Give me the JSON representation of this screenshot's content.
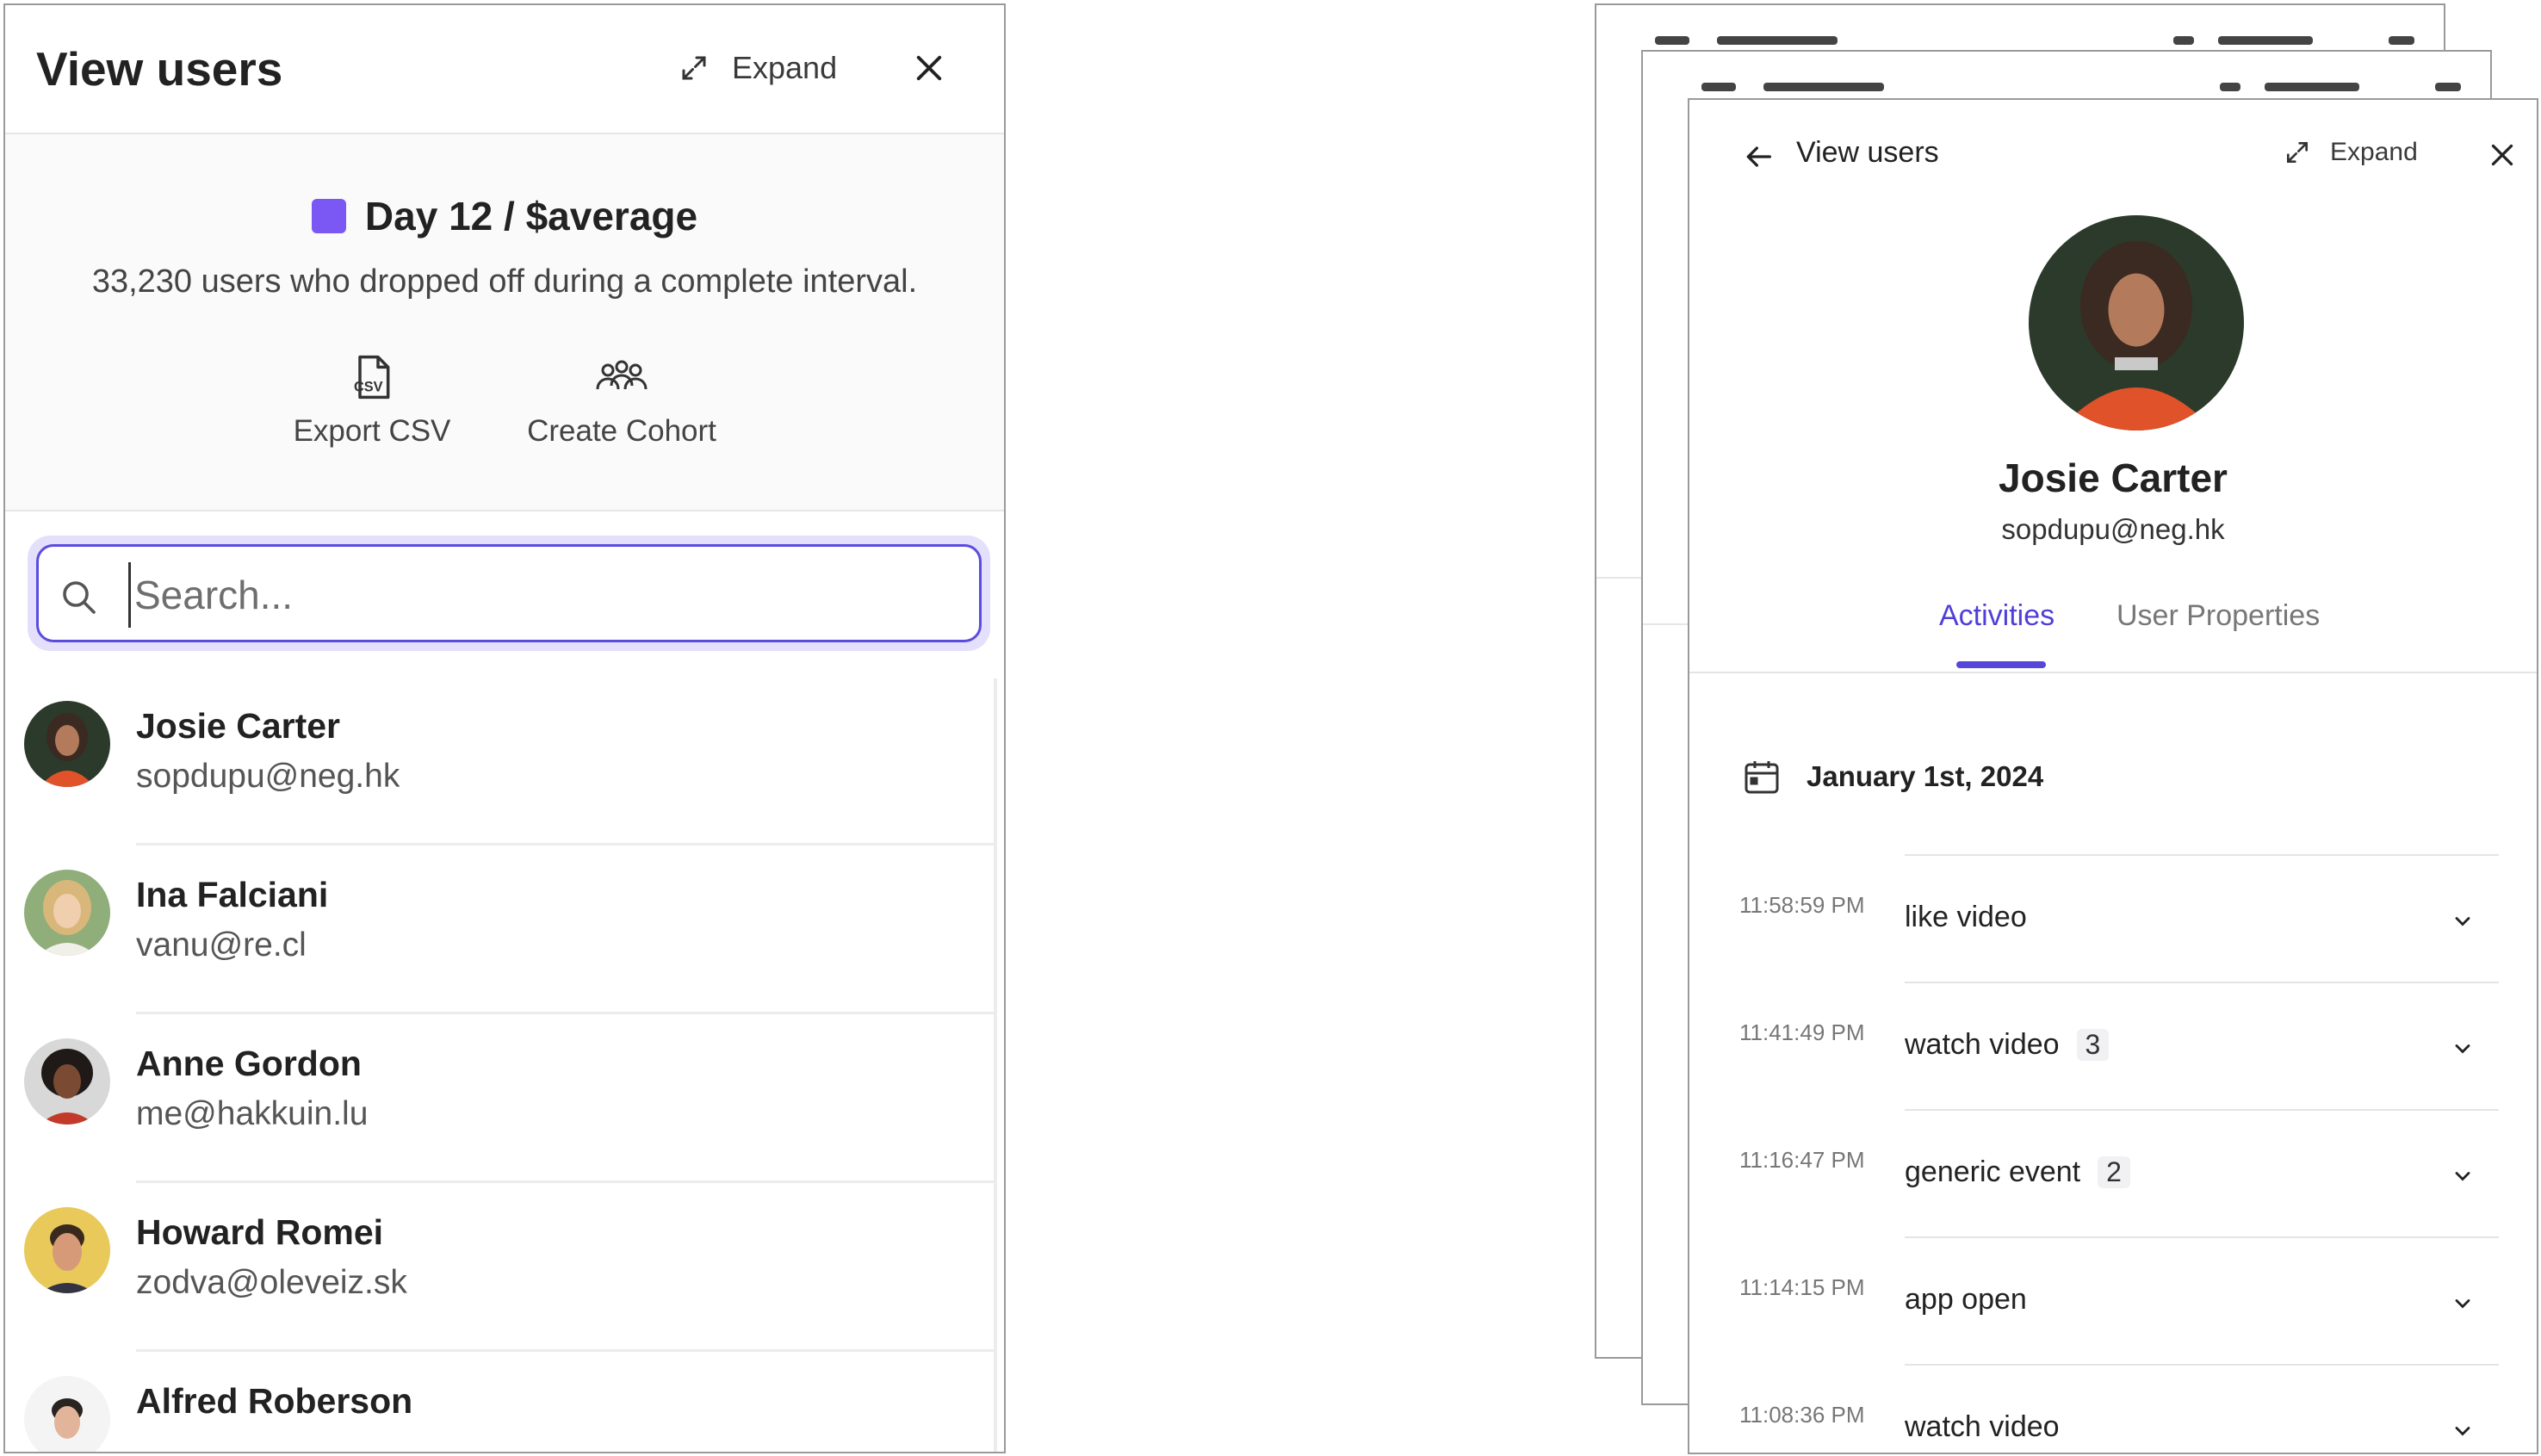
{
  "left_panel": {
    "title": "View users",
    "expand_label": "Expand",
    "summary": {
      "title": "Day 12 / $average",
      "swatch_color": "#7b57f4",
      "description": "33,230 users who dropped off during a complete interval."
    },
    "actions": {
      "export_csv": "Export CSV",
      "create_cohort": "Create Cohort"
    },
    "search": {
      "placeholder": "Search...",
      "value": ""
    },
    "users": [
      {
        "name": "Josie Carter",
        "email": "sopdupu@neg.hk"
      },
      {
        "name": "Ina Falciani",
        "email": "vanu@re.cl"
      },
      {
        "name": "Anne Gordon",
        "email": "me@hakkuin.lu"
      },
      {
        "name": "Howard Romei",
        "email": "zodva@oleveiz.sk"
      },
      {
        "name": "Alfred Roberson",
        "email": ""
      }
    ]
  },
  "detail_panel": {
    "title": "View users",
    "expand_label": "Expand",
    "user": {
      "name": "Josie Carter",
      "email": "sopdupu@neg.hk"
    },
    "tabs": [
      {
        "label": "Activities",
        "active": true
      },
      {
        "label": "User Properties",
        "active": false
      }
    ],
    "date": "January 1st, 2024",
    "events": [
      {
        "time": "11:58:59 PM",
        "name": "like video",
        "count": ""
      },
      {
        "time": "11:41:49 PM",
        "name": "watch video",
        "count": "3"
      },
      {
        "time": "11:16:47 PM",
        "name": "generic event",
        "count": "2"
      },
      {
        "time": "11:14:15 PM",
        "name": "app open",
        "count": ""
      },
      {
        "time": "11:08:36 PM",
        "name": "watch video",
        "count": ""
      }
    ],
    "accent_color": "#4f3fd9"
  }
}
